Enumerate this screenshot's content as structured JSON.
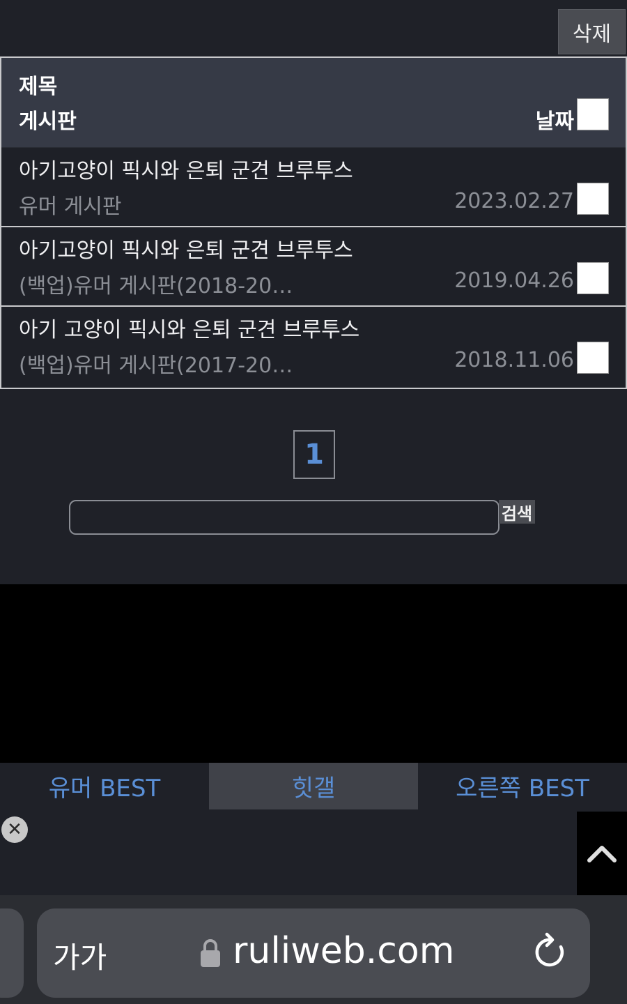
{
  "toolbar": {
    "delete_label": "삭제"
  },
  "table": {
    "header": {
      "title": "제목",
      "board": "게시판",
      "date": "날짜"
    },
    "rows": [
      {
        "title": "아기고양이 픽시와 은퇴 군견 브루투스",
        "board": "유머 게시판",
        "date": "2023.02.27"
      },
      {
        "title": "아기고양이 픽시와 은퇴 군견 브루투스",
        "board": "(백업)유머 게시판(2018-20…",
        "date": "2019.04.26"
      },
      {
        "title": "아기 고양이 픽시와 은퇴 군견 브루투스",
        "board": "(백업)유머 게시판(2017-20…",
        "date": "2018.11.06"
      }
    ]
  },
  "pagination": {
    "current": "1"
  },
  "search": {
    "button_label": "검색",
    "value": ""
  },
  "bottom_tabs": [
    {
      "label": "유머 BEST"
    },
    {
      "label": "힛갤"
    },
    {
      "label": "오른쪽 BEST"
    }
  ],
  "browser": {
    "text_size_label": "가가",
    "url": "ruliweb.com"
  },
  "colors": {
    "accent": "#5a8fd6",
    "background": "#1f2128",
    "header": "#363a46"
  }
}
